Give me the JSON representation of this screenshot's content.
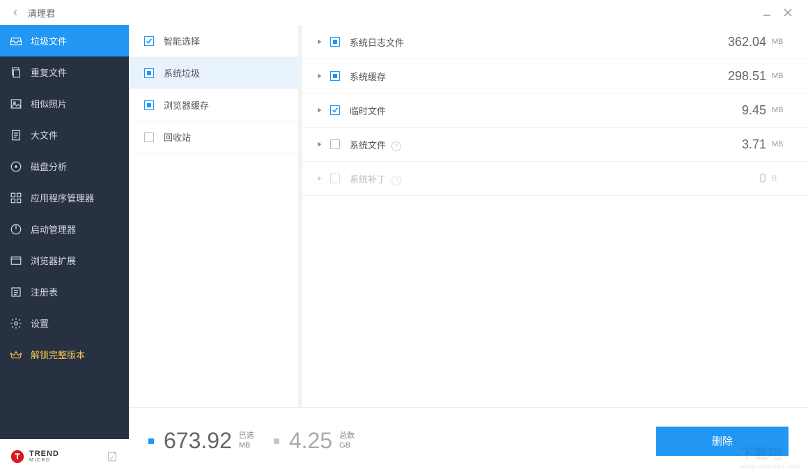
{
  "title": "清理君",
  "sidebar": {
    "items": [
      {
        "label": "垃圾文件"
      },
      {
        "label": "重复文件"
      },
      {
        "label": "相似照片"
      },
      {
        "label": "大文件"
      },
      {
        "label": "磁盘分析"
      },
      {
        "label": "应用程序管理器"
      },
      {
        "label": "启动管理器"
      },
      {
        "label": "浏览器扩展"
      },
      {
        "label": "注册表"
      },
      {
        "label": "设置"
      },
      {
        "label": "解锁完整版本"
      }
    ]
  },
  "brand": {
    "line1": "TREND",
    "line2": "MICRO"
  },
  "categories": [
    {
      "label": "智能选择"
    },
    {
      "label": "系统垃圾"
    },
    {
      "label": "浏览器缓存"
    },
    {
      "label": "回收站"
    }
  ],
  "rows": [
    {
      "name": "系统日志文件",
      "size": "362.04",
      "unit": "MB",
      "state": "filled"
    },
    {
      "name": "系统缓存",
      "size": "298.51",
      "unit": "MB",
      "state": "filled"
    },
    {
      "name": "临时文件",
      "size": "9.45",
      "unit": "MB",
      "state": "check"
    },
    {
      "name": "系统文件",
      "size": "3.71",
      "unit": "MB",
      "state": "empty",
      "help": true
    },
    {
      "name": "系统补丁",
      "size": "0",
      "unit": "B",
      "state": "empty",
      "help": true,
      "disabled": true
    }
  ],
  "footer": {
    "selected_value": "673.92",
    "selected_label": "已选",
    "selected_unit": "MB",
    "total_value": "4.25",
    "total_label": "总数",
    "total_unit": "GB",
    "delete_label": "删除"
  },
  "watermark": {
    "big": "下载吧",
    "small": "www.xiazaiba.com"
  }
}
